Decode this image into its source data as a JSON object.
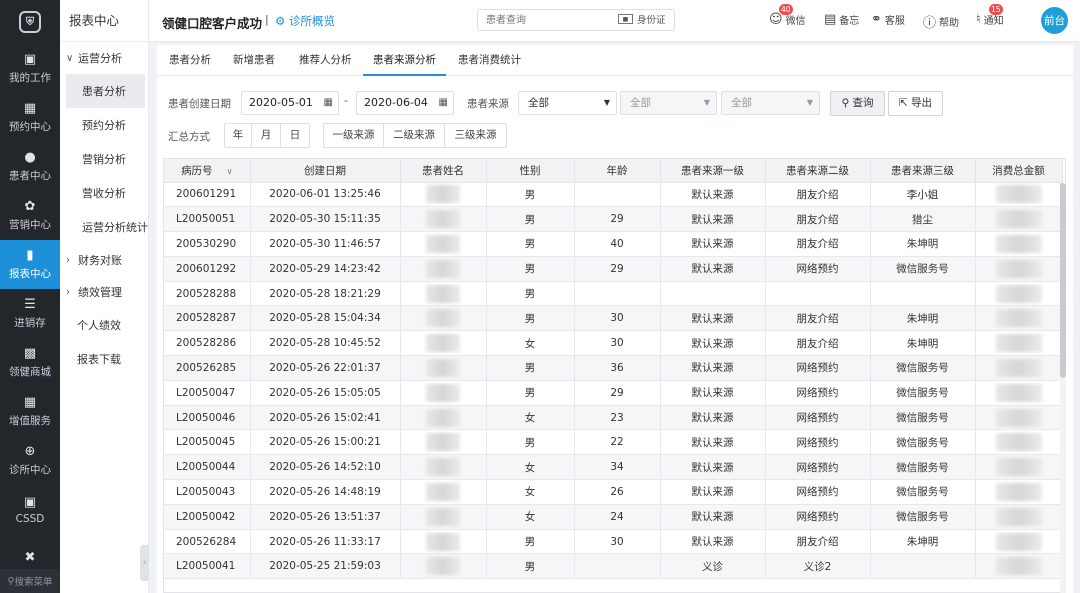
{
  "rail": {
    "logo": "⛨",
    "items": [
      {
        "label": "我的工作",
        "icon": "chart-icon"
      },
      {
        "label": "预约中心",
        "icon": "calendar-icon"
      },
      {
        "label": "患者中心",
        "icon": "user-icon"
      },
      {
        "label": "营销中心",
        "icon": "flower-icon"
      },
      {
        "label": "报表中心",
        "icon": "bar-icon"
      },
      {
        "label": "进销存",
        "icon": "layers-icon"
      },
      {
        "label": "领健商城",
        "icon": "shop-icon"
      },
      {
        "label": "增值服务",
        "icon": "grid-icon"
      },
      {
        "label": "诊所中心",
        "icon": "plus-icon"
      },
      {
        "label": "CSSD",
        "icon": "box-icon"
      },
      {
        "label": "",
        "icon": "tools-icon"
      }
    ],
    "search_label": "搜索菜单"
  },
  "menu": {
    "title": "报表中心",
    "group1": "运营分析",
    "items": [
      "患者分析",
      "预约分析",
      "营销分析",
      "营收分析",
      "运营分析统计"
    ],
    "group2": "财务对账",
    "group3": "绩效管理",
    "item_perf": "个人绩效",
    "item_download": "报表下载"
  },
  "header": {
    "clinic": "领健口腔客户成功",
    "sep": "|",
    "overview": "诊所概览",
    "search_placeholder": "患者查询",
    "idcard": "身份证",
    "wechat": "微信",
    "wechat_badge": "40",
    "memo": "备忘",
    "service": "客服",
    "help": "帮助",
    "notify": "通知",
    "notify_badge": "15",
    "user": "前台"
  },
  "tabs": [
    "患者分析",
    "新增患者",
    "推荐人分析",
    "患者来源分析",
    "患者消费统计"
  ],
  "filters": {
    "date_label": "患者创建日期",
    "date_from": "2020-05-01",
    "date_dash": "-",
    "date_to": "2020-06-04",
    "source_label": "患者来源",
    "source1": "全部",
    "source2": "全部",
    "source3": "全部",
    "query": "查询",
    "export": "导出",
    "summary_label": "汇总方式",
    "summary_opts": [
      "年",
      "月",
      "日"
    ],
    "level_opts": [
      "一级来源",
      "二级来源",
      "三级来源"
    ]
  },
  "table": {
    "headers": [
      "病历号",
      "创建日期",
      "患者姓名",
      "性别",
      "年龄",
      "患者来源一级",
      "患者来源二级",
      "患者来源三级",
      "消费总金额"
    ],
    "rows": [
      [
        "200601291",
        "2020-06-01 13:25:46",
        "",
        "男",
        "",
        "默认来源",
        "朋友介绍",
        "李小姐",
        ""
      ],
      [
        "L20050051",
        "2020-05-30 15:11:35",
        "",
        "男",
        "29",
        "默认来源",
        "朋友介绍",
        "猎尘",
        ""
      ],
      [
        "200530290",
        "2020-05-30 11:46:57",
        "",
        "男",
        "40",
        "默认来源",
        "朋友介绍",
        "朱坤明",
        ""
      ],
      [
        "200601292",
        "2020-05-29 14:23:42",
        "",
        "男",
        "29",
        "默认来源",
        "网络预约",
        "微信服务号",
        ""
      ],
      [
        "200528288",
        "2020-05-28 18:21:29",
        "",
        "男",
        "",
        "",
        "",
        "",
        ""
      ],
      [
        "200528287",
        "2020-05-28 15:04:34",
        "",
        "男",
        "30",
        "默认来源",
        "朋友介绍",
        "朱坤明",
        ""
      ],
      [
        "200528286",
        "2020-05-28 10:45:52",
        "",
        "女",
        "30",
        "默认来源",
        "朋友介绍",
        "朱坤明",
        ""
      ],
      [
        "200526285",
        "2020-05-26 22:01:37",
        "",
        "男",
        "36",
        "默认来源",
        "网络预约",
        "微信服务号",
        ""
      ],
      [
        "L20050047",
        "2020-05-26 15:05:05",
        "",
        "男",
        "29",
        "默认来源",
        "网络预约",
        "微信服务号",
        ""
      ],
      [
        "L20050046",
        "2020-05-26 15:02:41",
        "",
        "女",
        "23",
        "默认来源",
        "网络预约",
        "微信服务号",
        ""
      ],
      [
        "L20050045",
        "2020-05-26 15:00:21",
        "",
        "男",
        "22",
        "默认来源",
        "网络预约",
        "微信服务号",
        ""
      ],
      [
        "L20050044",
        "2020-05-26 14:52:10",
        "",
        "女",
        "34",
        "默认来源",
        "网络预约",
        "微信服务号",
        ""
      ],
      [
        "L20050043",
        "2020-05-26 14:48:19",
        "",
        "女",
        "26",
        "默认来源",
        "网络预约",
        "微信服务号",
        ""
      ],
      [
        "L20050042",
        "2020-05-26 13:51:37",
        "",
        "女",
        "24",
        "默认来源",
        "网络预约",
        "微信服务号",
        ""
      ],
      [
        "200526284",
        "2020-05-26 11:33:17",
        "",
        "男",
        "30",
        "默认来源",
        "朋友介绍",
        "朱坤明",
        ""
      ],
      [
        "L20050041",
        "2020-05-25 21:59:03",
        "",
        "男",
        "",
        "义诊",
        "义诊2",
        "",
        ""
      ]
    ]
  },
  "colors": {
    "accent": "#1e8fd9",
    "rail": "#23262b",
    "badge": "#f24b4b"
  }
}
